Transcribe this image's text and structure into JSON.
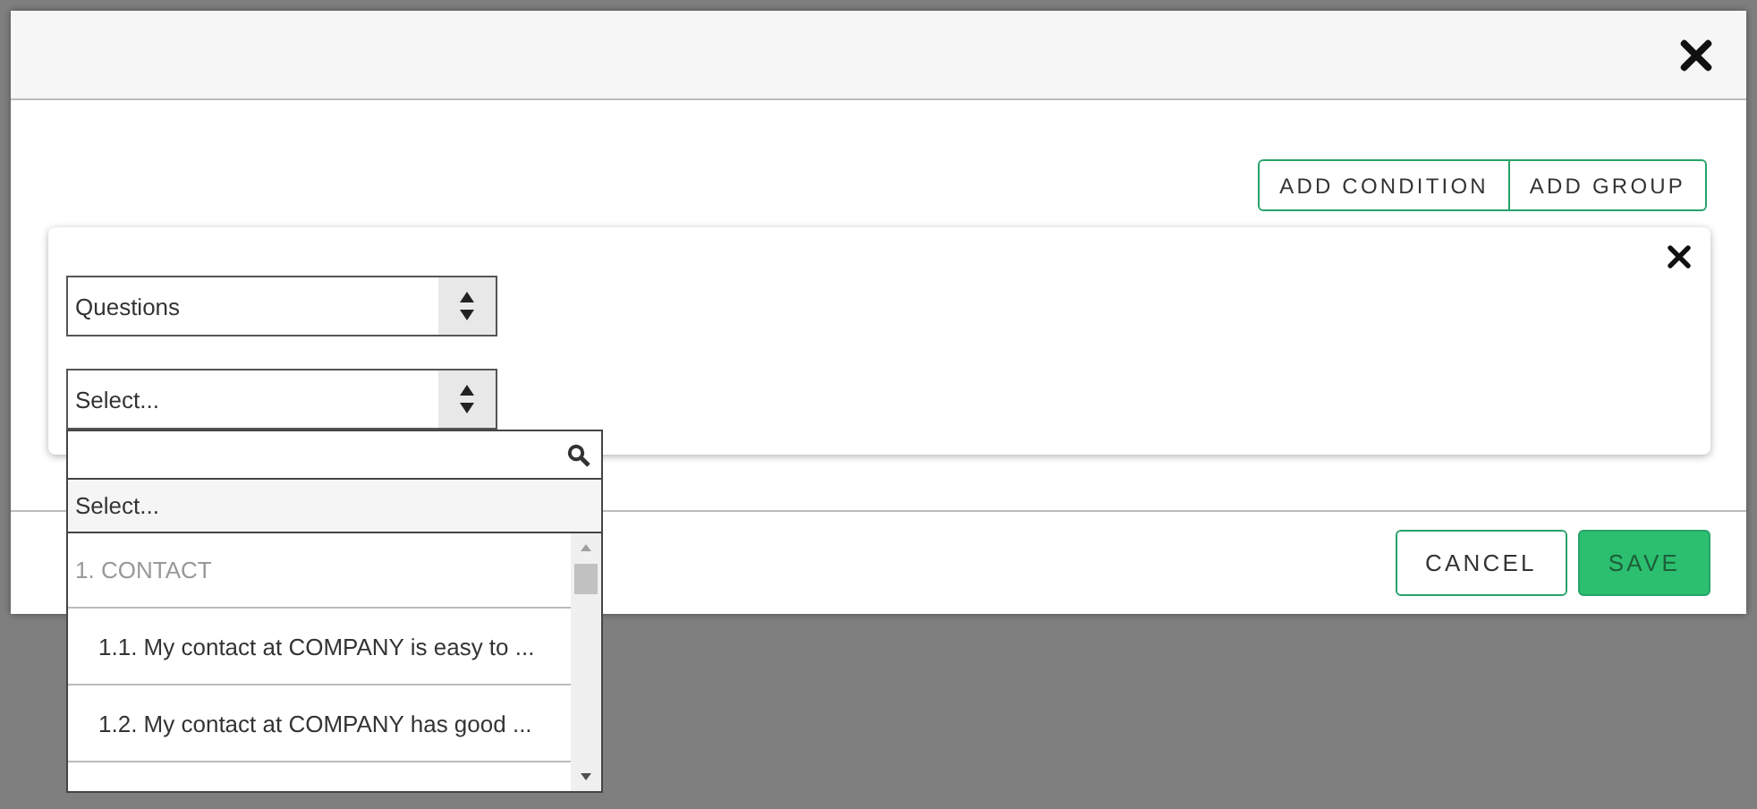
{
  "toolbar_buttons": [
    {
      "label": "ADD CONDITION"
    },
    {
      "label": "ADD GROUP"
    }
  ],
  "condition": {
    "selects": [
      {
        "value": "Questions",
        "open": false
      },
      {
        "placeholder": "Select...",
        "open": true,
        "options": [
          {
            "label": "Select...",
            "kind": "placeholder",
            "selected": true
          },
          {
            "label": "1. CONTACT",
            "kind": "group",
            "selected": false
          },
          {
            "label": "1.1. My contact at COMPANY is easy to ...",
            "kind": "item",
            "selected": false
          },
          {
            "label": "1.2. My contact at COMPANY has good ...",
            "kind": "item",
            "selected": false
          }
        ]
      }
    ]
  },
  "footer_buttons": [
    {
      "label": "CANCEL",
      "kind": "secondary"
    },
    {
      "label": "SAVE",
      "kind": "primary"
    }
  ]
}
